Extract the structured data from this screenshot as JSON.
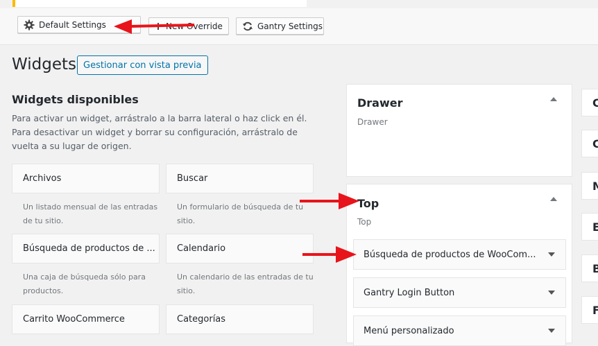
{
  "toolbar": {
    "default_settings": "Default Settings",
    "new_override": "New Override",
    "gantry_settings": "Gantry Settings"
  },
  "page": {
    "title": "Widgets",
    "manage_preview": "Gestionar con vista previa"
  },
  "available": {
    "title": "Widgets disponibles",
    "description": "Para activar un widget, arrástralo a la barra lateral o haz click en él. Para desactivar un widget y borrar su configuración, arrástralo de vuelta a su lugar de origen.",
    "widgets": [
      {
        "name": "Archivos",
        "desc": "Un listado mensual de las entradas de tu sitio."
      },
      {
        "name": "Buscar",
        "desc": "Un formulario de búsqueda de tu sitio."
      },
      {
        "name": "Búsqueda de productos de ...",
        "desc": "Una caja de búsqueda sólo para productos."
      },
      {
        "name": "Calendario",
        "desc": "Un calendario de las entradas de tu sitio."
      },
      {
        "name": "Carrito WooCommerce",
        "desc": ""
      },
      {
        "name": "Categorías",
        "desc": ""
      }
    ]
  },
  "areas": {
    "drawer": {
      "title": "Drawer",
      "sub": "Drawer"
    },
    "top": {
      "title": "Top",
      "sub": "Top",
      "widgets": [
        "Búsqueda de productos de WooCom...",
        "Gantry Login Button",
        "Menú personalizado"
      ]
    }
  },
  "side_letters": [
    "C",
    "C",
    "M",
    "E",
    "B",
    "F"
  ],
  "colors": {
    "accent": "#0073aa",
    "arrow": "#e8141b",
    "notice": "#ffb900"
  },
  "icons": [
    "gear-icon",
    "plus-icon",
    "sync-icon"
  ]
}
